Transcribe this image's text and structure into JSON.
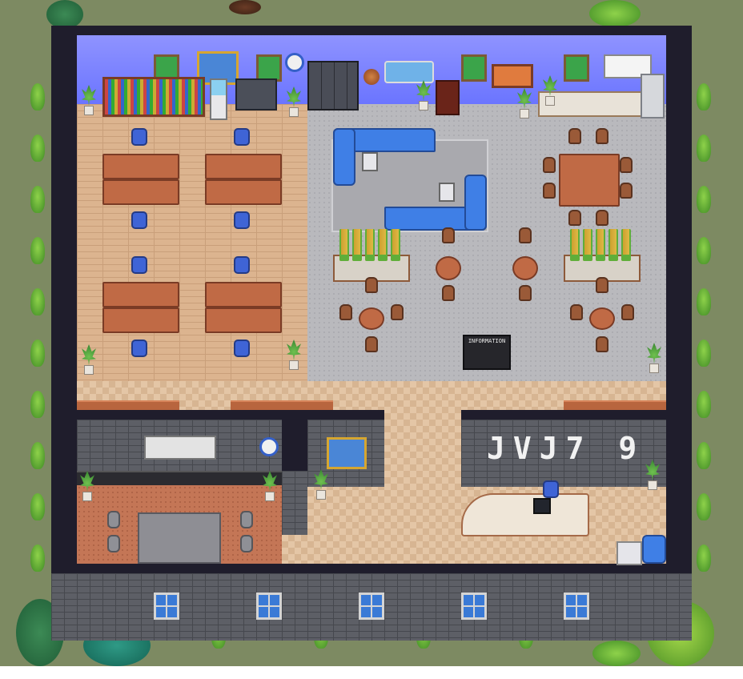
{
  "info_board": {
    "title": "INFORMATION"
  },
  "reception_sign": {
    "text": "JVJ7 9"
  },
  "colors": {
    "outer_wall": "#1f1d2c",
    "back_wall": "#6a74ff",
    "grass": "#7d8a62",
    "desk_wood": "#c06a45",
    "sofa_blue": "#3f7fe6"
  },
  "icons": [
    "wall-clock-icon",
    "globe-icon",
    "ship-painting-icon",
    "water-cooler-icon",
    "printer-icon",
    "potted-plant-icon",
    "computer-monitor-icon"
  ]
}
